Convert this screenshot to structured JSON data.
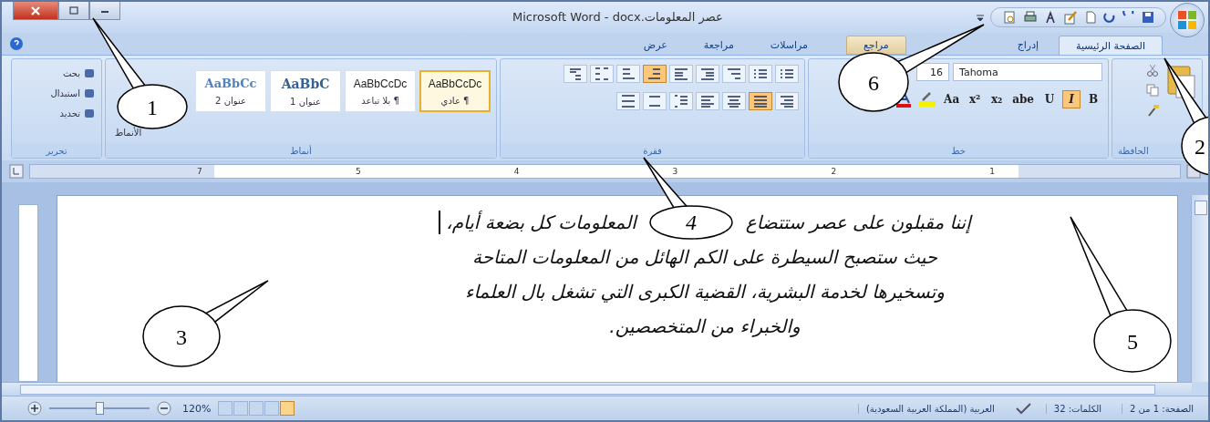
{
  "window": {
    "title": "Microsoft Word - docx.عصر المعلومات"
  },
  "tabs": [
    {
      "label": "الصفحة الرئيسية",
      "selected": true,
      "highlighted": false
    },
    {
      "label": "إدراج",
      "selected": false,
      "highlighted": false
    },
    {
      "label": "مراجع",
      "selected": false,
      "highlighted": true
    },
    {
      "label": "مراسلات",
      "selected": false,
      "highlighted": false
    },
    {
      "label": "مراجعة",
      "selected": false,
      "highlighted": false
    },
    {
      "label": "عرض",
      "selected": false,
      "highlighted": false
    }
  ],
  "ribbon": {
    "clipboard": {
      "label": "الحافظة"
    },
    "font": {
      "label": "خط",
      "name": "Tahoma",
      "size": "16",
      "buttons": [
        {
          "glyph": "B",
          "selected": false
        },
        {
          "glyph": "I",
          "selected": true
        },
        {
          "glyph": "U",
          "selected": false
        },
        {
          "glyph": "abe",
          "selected": false
        },
        {
          "glyph": "x₂",
          "selected": false
        },
        {
          "glyph": "x²",
          "selected": false
        },
        {
          "glyph": "Aa",
          "selected": false
        }
      ]
    },
    "paragraph": {
      "label": "فقرة",
      "rows": [
        [
          {
            "kind": "bullets",
            "selected": false
          },
          {
            "kind": "numbering",
            "selected": false
          },
          {
            "kind": "multilevel",
            "selected": false
          },
          {
            "kind": "outdent",
            "selected": false
          },
          {
            "kind": "indent",
            "selected": false
          },
          {
            "kind": "rtl",
            "selected": true
          },
          {
            "kind": "ltr",
            "selected": false
          },
          {
            "kind": "sort",
            "selected": false
          },
          {
            "kind": "pilcrow",
            "selected": false
          }
        ],
        [
          {
            "kind": "align-right",
            "selected": false
          },
          {
            "kind": "justify",
            "selected": true
          },
          {
            "kind": "center",
            "selected": false
          },
          {
            "kind": "align-left",
            "selected": false
          },
          {
            "kind": "spacing",
            "selected": false
          },
          {
            "kind": "shading",
            "selected": false
          },
          {
            "kind": "borders",
            "selected": false
          }
        ]
      ]
    },
    "styles": {
      "label": "أنماط",
      "items": [
        {
          "sample": "AaBbCcDc",
          "name": "¶ عادي",
          "kind": "normal",
          "selected": true
        },
        {
          "sample": "AaBbCcDc",
          "name": "¶ بلا تباعد",
          "kind": "normal",
          "selected": false
        },
        {
          "sample": "AaBbC",
          "name": "عنوان 1",
          "kind": "heading",
          "selected": false
        },
        {
          "sample": "AaBbCc",
          "name": "عنوان 2",
          "kind": "subheading",
          "selected": false
        }
      ],
      "change_styles": "الأنماط"
    },
    "editing": {
      "label": "تحرير",
      "items": [
        "بحث",
        "استبدال",
        "تحديد"
      ]
    }
  },
  "ruler": {
    "numbers": [
      "1",
      "2",
      "3",
      "4",
      "5",
      "7"
    ]
  },
  "document": {
    "lines": [
      [
        "إننا مقبلون على عصر ستتضاع",
        "المعلومات كل بضعة أيام،"
      ],
      [
        "حيث ستصبح السيطرة على الكم الهائل من المعلومات المتاحة"
      ],
      [
        "وتسخيرها لخدمة البشرية، القضية الكبرى التي تشغل بال العلماء"
      ],
      [
        "والخبراء من المتخصصين."
      ]
    ]
  },
  "status_bar": {
    "page": "الصفحة: 1 من 2",
    "words": "الكلمات: 32",
    "language": "العربية (المملكة العربية السعودية)",
    "zoom": "120%",
    "zoom_slider": {
      "level": 0.5
    },
    "views": [
      {
        "selected": false
      },
      {
        "selected": false
      },
      {
        "selected": false
      },
      {
        "selected": false
      },
      {
        "selected": true
      }
    ]
  },
  "callouts": [
    "1",
    "2",
    "3",
    "4",
    "5",
    "6"
  ]
}
